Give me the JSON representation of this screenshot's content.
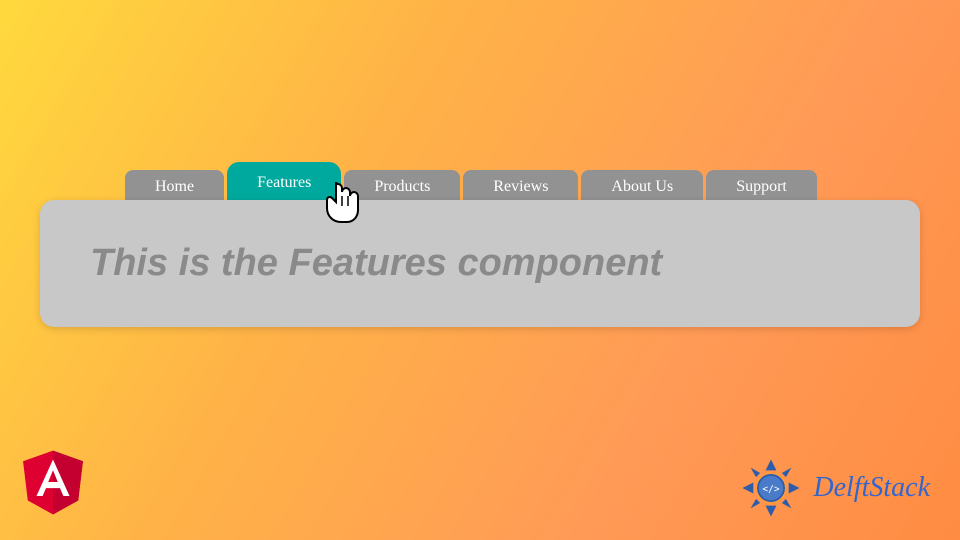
{
  "tabs": [
    {
      "label": "Home",
      "active": false
    },
    {
      "label": "Features",
      "active": true
    },
    {
      "label": "Products",
      "active": false
    },
    {
      "label": "Reviews",
      "active": false
    },
    {
      "label": "About Us",
      "active": false
    },
    {
      "label": "Support",
      "active": false
    }
  ],
  "content": {
    "heading": "This is the Features component"
  },
  "logos": {
    "angular": "Angular",
    "delft": "DelftStack"
  },
  "colors": {
    "tab_active": "#00a99d",
    "tab_inactive": "#929292",
    "panel_bg": "#c8c8c8",
    "heading_color": "#8a8a8a",
    "angular_red": "#dd0031",
    "delft_blue": "#3366cc"
  }
}
